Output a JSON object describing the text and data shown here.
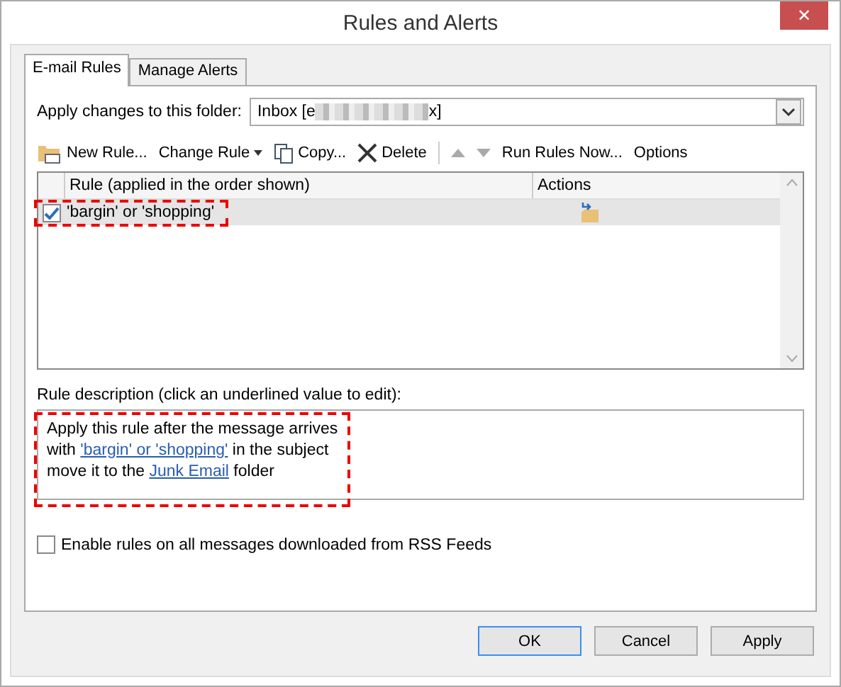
{
  "window": {
    "title": "Rules and Alerts",
    "close": "✕"
  },
  "tabs": [
    {
      "label": "E-mail Rules",
      "selected": true
    },
    {
      "label": "Manage Alerts",
      "selected": false
    }
  ],
  "folder": {
    "label": "Apply changes to this folder:",
    "value_start": "Inbox [e",
    "value_end": "x]"
  },
  "toolbar": [
    {
      "kind": "new",
      "label": "New Rule...",
      "disabled": false
    },
    {
      "kind": "change",
      "label": "Change Rule",
      "disabled": false
    },
    {
      "kind": "copy",
      "label": "Copy...",
      "disabled": false
    },
    {
      "kind": "delete",
      "label": "Delete",
      "disabled": false
    },
    {
      "kind": "separator"
    },
    {
      "kind": "up",
      "disabled": true
    },
    {
      "kind": "down",
      "disabled": true
    },
    {
      "kind": "run",
      "label": "Run Rules Now...",
      "disabled": false
    },
    {
      "kind": "options",
      "label": "Options",
      "disabled": false
    }
  ],
  "table": {
    "columns": [
      "Rule (applied in the order shown)",
      "Actions"
    ],
    "rows": [
      {
        "name": "'bargin' or 'shopping'",
        "checked": true,
        "selected": true,
        "highlighted": true
      }
    ]
  },
  "description": {
    "label": "Rule description (click an underlined value to edit):",
    "highlighted": true,
    "lines": [
      [
        {
          "text": "Apply this rule after the message arrives",
          "link": false
        }
      ],
      [
        {
          "text": "with ",
          "link": false
        },
        {
          "text": "'bargin' or 'shopping'",
          "link": true
        },
        {
          "text": " in the subject",
          "link": false
        }
      ],
      [
        {
          "text": "move it to the ",
          "link": false
        },
        {
          "text": "Junk Email",
          "link": true
        },
        {
          "text": " folder",
          "link": false
        }
      ]
    ]
  },
  "rss": {
    "label": "Enable rules on all messages downloaded from RSS Feeds",
    "checked": false
  },
  "buttons": [
    {
      "label": "OK",
      "default": true
    },
    {
      "label": "Cancel",
      "default": false
    },
    {
      "label": "Apply",
      "default": false
    }
  ]
}
